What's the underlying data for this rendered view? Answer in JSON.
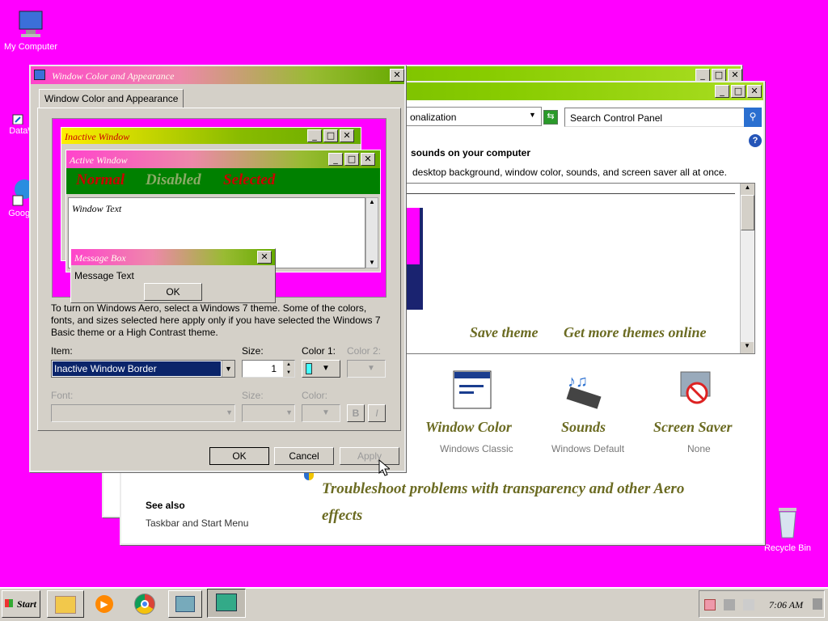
{
  "desktop": {
    "my_computer": "My Computer",
    "dataw": "DataW",
    "google": "Google",
    "recycle": "Recycle Bin"
  },
  "cp": {
    "breadcrumb": "onalization",
    "search_placeholder": "Search Control Panel",
    "heading": "sounds on your computer",
    "subtitle": "desktop background, window color, sounds, and screen saver all at once.",
    "save_theme": "Save theme",
    "get_more": "Get more themes online",
    "window_color": "Window Color",
    "window_color_sub": "Windows Classic",
    "sounds": "Sounds",
    "sounds_sub": "Windows Default",
    "screen_saver": "Screen Saver",
    "screen_saver_sub": "None",
    "see_also": "See also",
    "taskbar_link": "Taskbar and Start Menu",
    "troubleshoot": "Troubleshoot problems with transparency and other Aero effects"
  },
  "dialog": {
    "title": "Window Color and Appearance",
    "tab": "Window Color and Appearance",
    "preview": {
      "inactive": "Inactive Window",
      "active": "Active Window",
      "normal": "Normal",
      "disabled": "Disabled",
      "selected": "Selected",
      "window_text": "Window Text",
      "msgbox": "Message Box",
      "msg_text": "Message Text",
      "ok": "OK"
    },
    "info": "To turn on Windows Aero, select a Windows 7 theme.  Some of the colors, fonts, and sizes selected here apply only if you have selected the Windows 7 Basic theme or a High Contrast theme.",
    "item_label": "Item:",
    "item_value": "Inactive Window Border",
    "size_label": "Size:",
    "size_value": "1",
    "color1_label": "Color 1:",
    "color2_label": "Color 2:",
    "font_label": "Font:",
    "font_size_label": "Size:",
    "font_color_label": "Color:",
    "bold": "B",
    "italic": "I",
    "ok": "OK",
    "cancel": "Cancel",
    "apply": "Apply"
  },
  "taskbar": {
    "start": "Start",
    "clock": "7:06 AM"
  }
}
